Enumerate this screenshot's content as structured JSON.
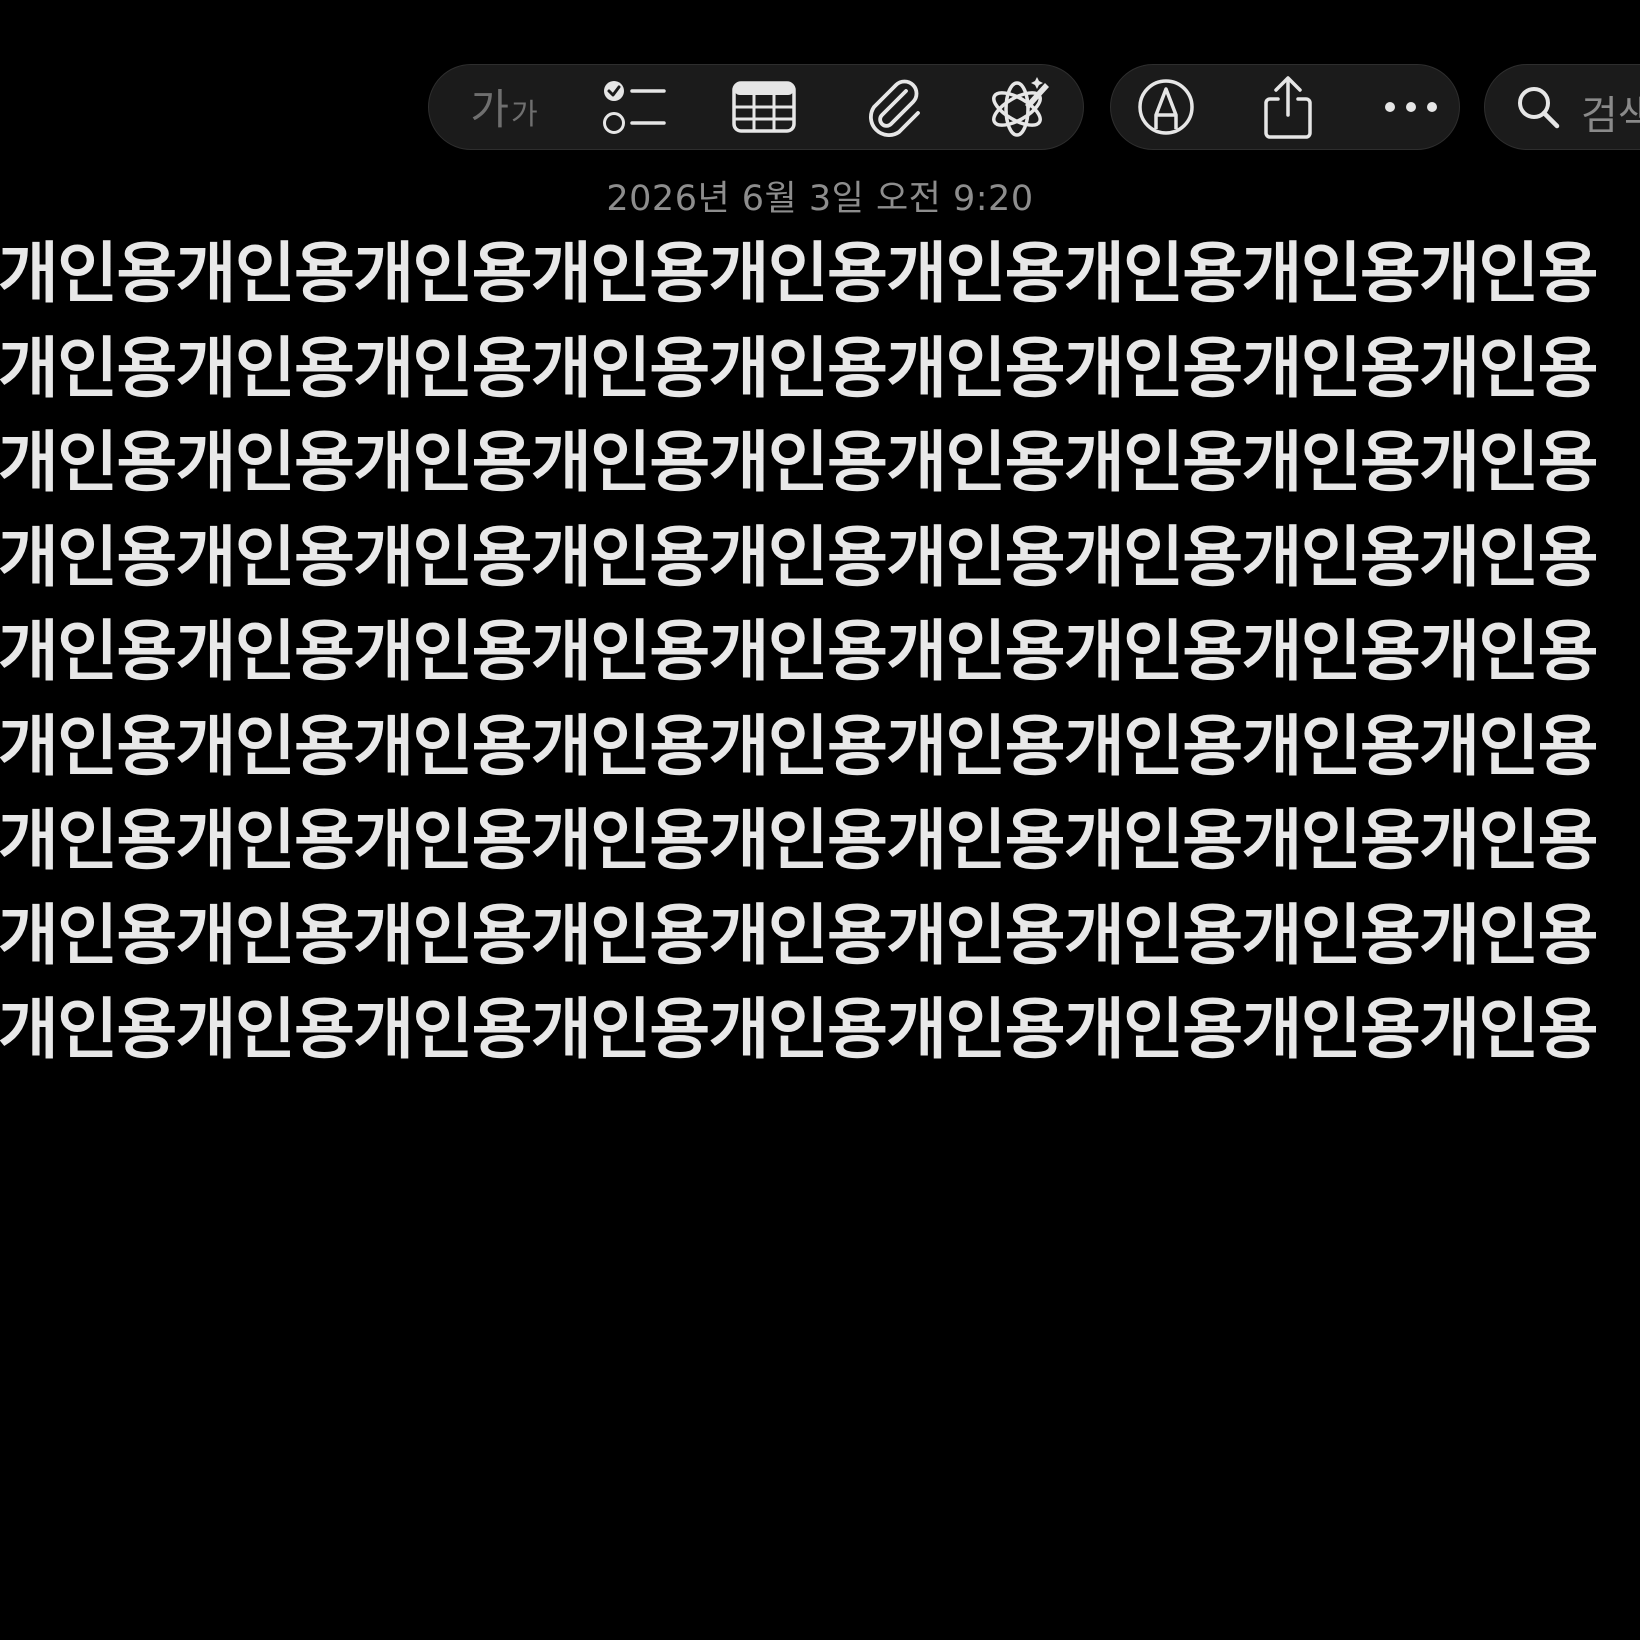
{
  "toolbar": {
    "format": {
      "text_big": "가",
      "text_small": "가"
    },
    "tools": [
      {
        "name": "checklist-icon"
      },
      {
        "name": "table-icon"
      },
      {
        "name": "paperclip-icon"
      },
      {
        "name": "writing-tools-icon"
      }
    ],
    "actions": [
      {
        "name": "markup-icon"
      },
      {
        "name": "share-icon"
      },
      {
        "name": "more-icon"
      }
    ],
    "search": {
      "icon": "search-icon",
      "label": "검색"
    }
  },
  "note": {
    "timestamp": "2026년 6월 3일 오전 9:20",
    "lines": [
      "개인용개인용개인용개인용개인용개인용개인용개인용개인용",
      "개인용개인용개인용개인용개인용개인용개인용개인용개인용",
      "개인용개인용개인용개인용개인용개인용개인용개인용개인용",
      "개인용개인용개인용개인용개인용개인용개인용개인용개인용",
      "개인용개인용개인용개인용개인용개인용개인용개인용개인용",
      "개인용개인용개인용개인용개인용개인용개인용개인용개인용",
      "개인용개인용개인용개인용개인용개인용개인용개인용개인용",
      "개인용개인용개인용개인용개인용개인용개인용개인용개인용",
      "개인용개인용개인용개인용개인용개인용개인용개인용개인용"
    ]
  },
  "colors": {
    "background": "#000000",
    "toolbar_bg": "#1b1b1b",
    "icon": "#e6e6e6",
    "text": "#e8e8e8",
    "muted": "#8d8d8d"
  }
}
